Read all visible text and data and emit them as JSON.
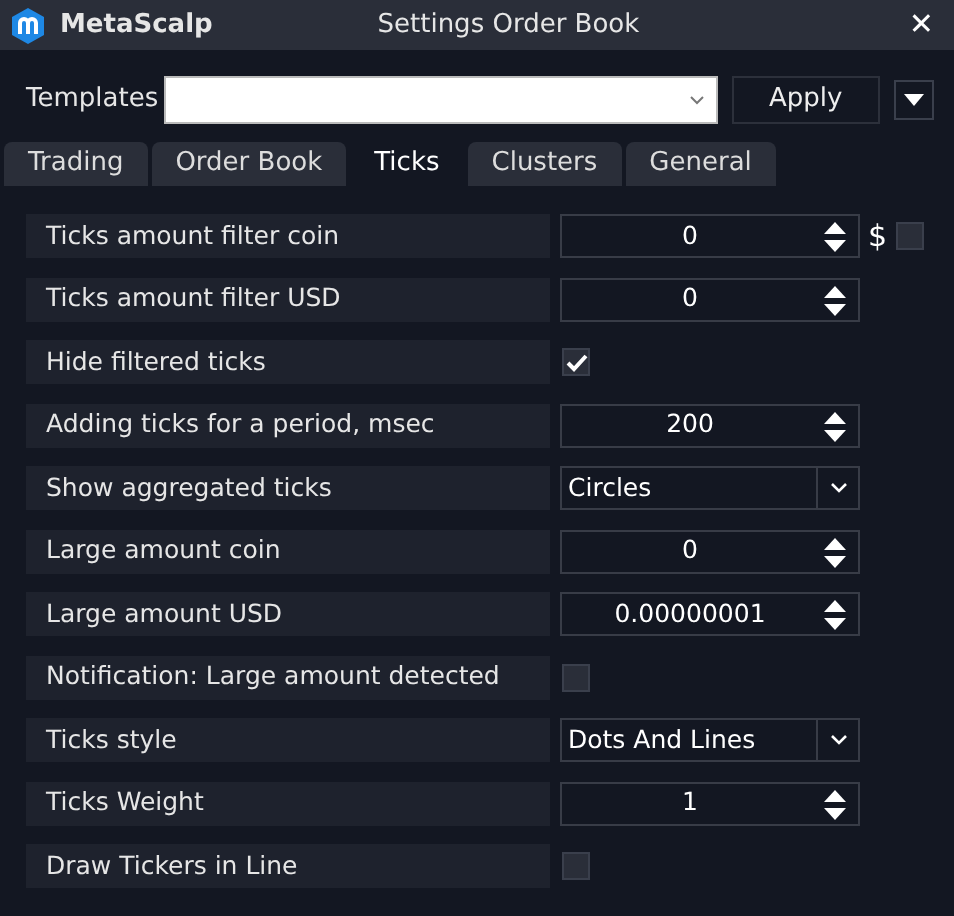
{
  "window": {
    "app_name": "MetaScalp",
    "title": "Settings Order Book",
    "close": "✕"
  },
  "templates": {
    "label": "Templates",
    "apply": "Apply"
  },
  "tabs": [
    {
      "label": "Trading",
      "selected": false
    },
    {
      "label": "Order Book",
      "selected": false
    },
    {
      "label": "Ticks",
      "selected": true
    },
    {
      "label": "Clusters",
      "selected": false
    },
    {
      "label": "General",
      "selected": false
    }
  ],
  "settings": [
    {
      "kind": "spin",
      "label": "Ticks amount filter coin",
      "value": "0",
      "suffix": "$",
      "suffix_checked": false
    },
    {
      "kind": "spin",
      "label": "Ticks amount filter USD",
      "value": "0"
    },
    {
      "kind": "checkbox",
      "label": "Hide filtered ticks",
      "checked": true
    },
    {
      "kind": "spin",
      "label": "Adding ticks for a period, msec",
      "value": "200"
    },
    {
      "kind": "select",
      "label": "Show aggregated ticks",
      "value": "Circles"
    },
    {
      "kind": "spin",
      "label": "Large amount coin",
      "value": "0"
    },
    {
      "kind": "spin",
      "label": "Large amount USD",
      "value": "0.00000001"
    },
    {
      "kind": "checkbox",
      "label": "Notification: Large amount detected",
      "checked": false
    },
    {
      "kind": "select",
      "label": "Ticks style",
      "value": "Dots And Lines"
    },
    {
      "kind": "spin",
      "label": "Ticks Weight",
      "value": "1"
    },
    {
      "kind": "checkbox",
      "label": "Draw Tickers in Line",
      "checked": false
    }
  ]
}
